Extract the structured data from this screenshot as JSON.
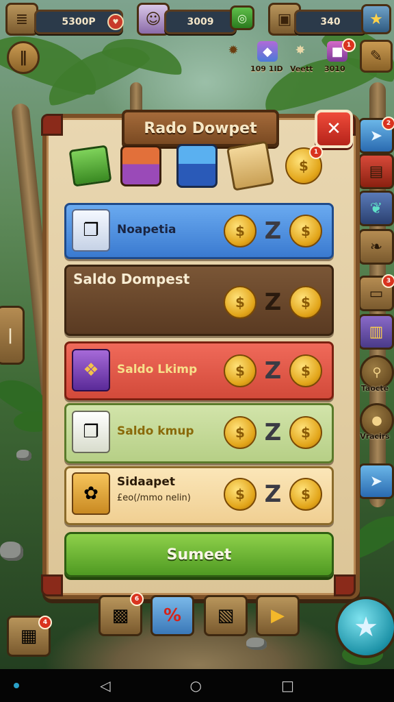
{
  "hud": {
    "currency1": "5300P",
    "currency2": "3009",
    "currency3": "340",
    "stat1": "109 1ID",
    "stat2": "Veett",
    "stat3": "3010"
  },
  "dialog": {
    "title": "Rado Dowpet",
    "close": "✕",
    "rows": [
      {
        "label": "Noapetia"
      },
      {
        "label": "Saldo Dompest"
      },
      {
        "label": "Saldo Lkimp"
      },
      {
        "label": "Saldo kmup"
      },
      {
        "label": "Sidaapet",
        "sublabel": "£eo(/mmo nelin)"
      }
    ],
    "coin_symbol": "$",
    "separator": "Z",
    "submit_label": "Sumeet"
  },
  "side": {
    "label1": "Taocte",
    "label2": "Vracirs"
  },
  "badges": {
    "top_chest": "1",
    "side1": "2",
    "side2": "3",
    "stat3": "1",
    "bottom1": "4",
    "bottom2": "6"
  },
  "colors": {
    "row_blue": "#4a8fe0",
    "row_brown": "#6a4a2e",
    "row_red": "#e45a4e",
    "row_green": "#c7dc9e",
    "row_cream": "#f4d9a4",
    "submit_green": "#6cb635"
  }
}
